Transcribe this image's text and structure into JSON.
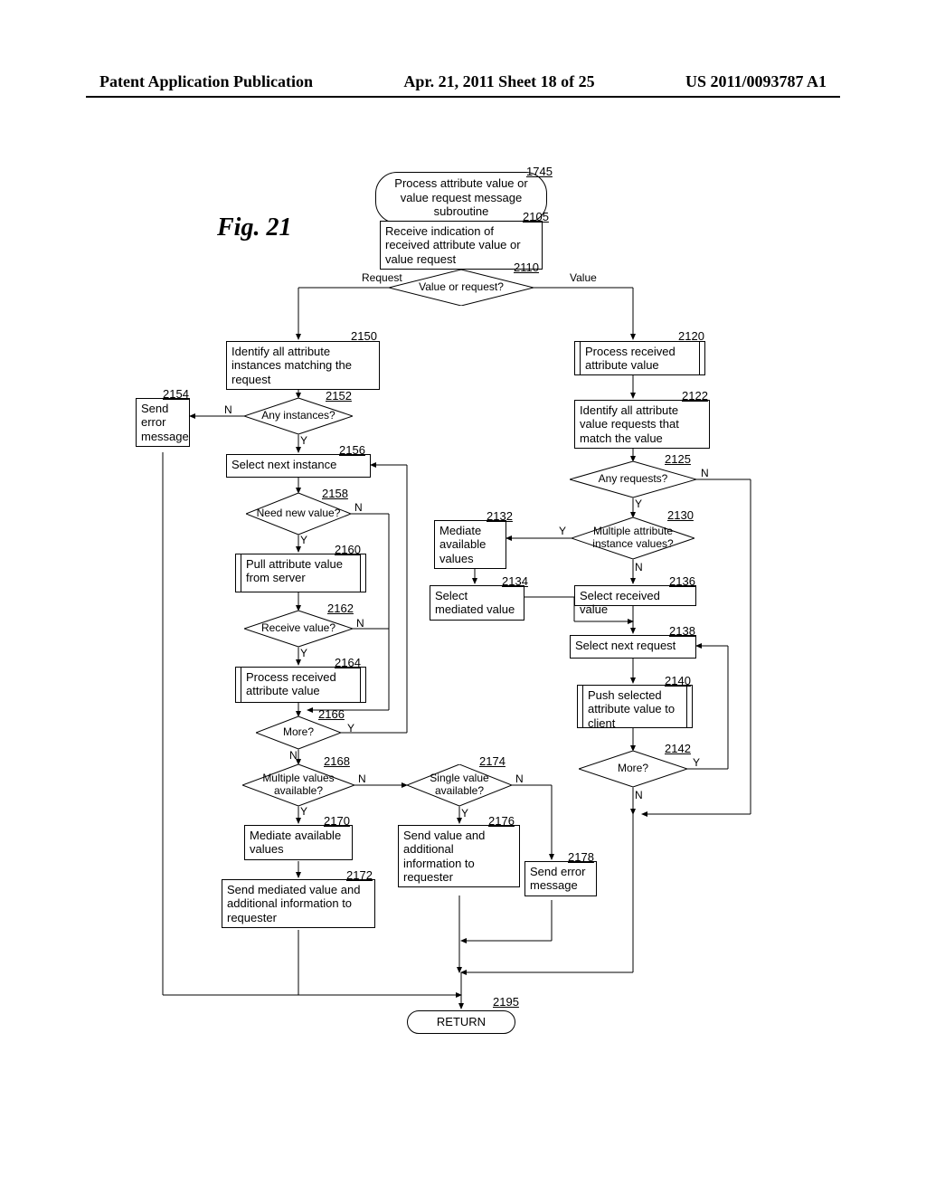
{
  "header": {
    "left": "Patent Application Publication",
    "center": "Apr. 21, 2011  Sheet 18 of 25",
    "right": "US 2011/0093787 A1"
  },
  "figure_title": "Fig. 21",
  "refs": {
    "r1745": "1745",
    "r2105": "2105",
    "r2110": "2110",
    "r2120": "2120",
    "r2122": "2122",
    "r2125": "2125",
    "r2130": "2130",
    "r2132": "2132",
    "r2134": "2134",
    "r2136": "2136",
    "r2138": "2138",
    "r2140": "2140",
    "r2142": "2142",
    "r2150": "2150",
    "r2152": "2152",
    "r2154": "2154",
    "r2156": "2156",
    "r2158": "2158",
    "r2160": "2160",
    "r2162": "2162",
    "r2164": "2164",
    "r2166": "2166",
    "r2168": "2168",
    "r2170": "2170",
    "r2172": "2172",
    "r2174": "2174",
    "r2176": "2176",
    "r2178": "2178",
    "r2195": "2195"
  },
  "nodes": {
    "start": "Process attribute value or value request message subroutine",
    "n2105": "Receive indication of received attribute value or value request",
    "n2110": "Value or request?",
    "lbl_request": "Request",
    "lbl_value": "Value",
    "n2150": "Identify all attribute instances matching the request",
    "n2152": "Any instances?",
    "n2154": "Send error message",
    "n2156": "Select next instance",
    "n2158": "Need new value?",
    "n2160": "Pull attribute value from server",
    "n2162": "Receive value?",
    "n2164": "Process received attribute value",
    "n2166": "More?",
    "n2168": "Multiple values available?",
    "n2170": "Mediate available values",
    "n2172": "Send mediated value and additional information to requester",
    "n2174": "Single value available?",
    "n2176": "Send value and additional information to requester",
    "n2178": "Send error message",
    "n2120": "Process received attribute value",
    "n2122": "Identify all attribute value requests that match the value",
    "n2125": "Any requests?",
    "n2130": "Multiple attribute instance values?",
    "n2132": "Mediate available values",
    "n2134": "Select mediated value",
    "n2136": "Select received value",
    "n2138": "Select next request",
    "n2140": "Push selected attribute value to client",
    "n2142": "More?",
    "ret": "RETURN"
  },
  "yn": {
    "Y": "Y",
    "N": "N"
  }
}
